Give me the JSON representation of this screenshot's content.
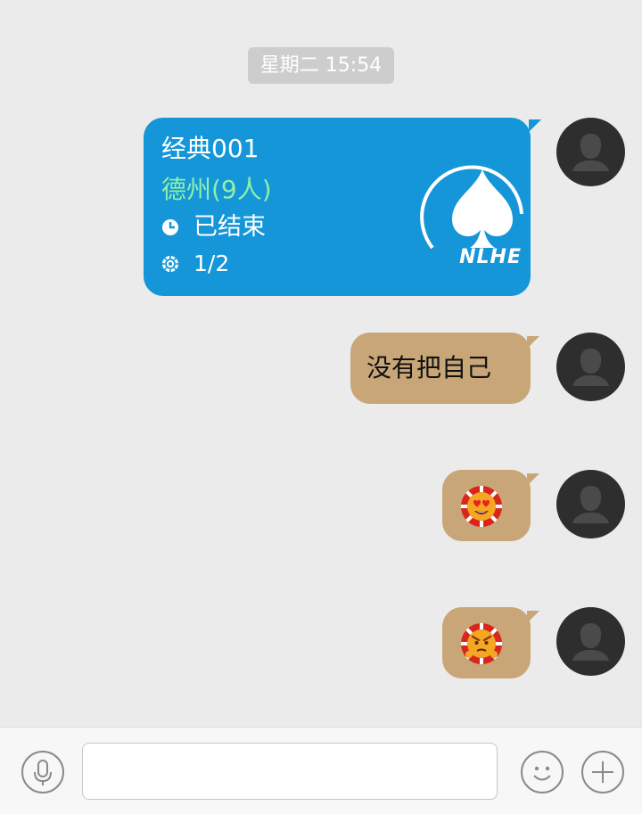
{
  "timestamp": "星期二 15:54",
  "messages": {
    "card": {
      "title": "经典001",
      "type": "德州(9人)",
      "status": "已结束",
      "progress": "1/2",
      "logo_text": "NLHE"
    },
    "text": "没有把自己"
  },
  "input": {
    "value": "",
    "placeholder": ""
  },
  "icons": {
    "voice": "microphone-icon",
    "emoji": "smiley-icon",
    "more": "plus-icon",
    "clock": "clock-icon",
    "chip": "poker-chip-icon"
  },
  "colors": {
    "card_bubble": "#1596d8",
    "text_bubble": "#c8a677",
    "card_type_text": "#8ef0a9",
    "background": "#ebebeb"
  }
}
